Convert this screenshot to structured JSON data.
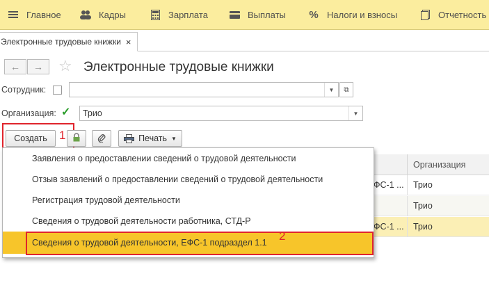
{
  "top_nav": [
    {
      "label": "Главное",
      "icon": "menu-icon"
    },
    {
      "label": "Кадры",
      "icon": "people-icon"
    },
    {
      "label": "Зарплата",
      "icon": "calculator-icon"
    },
    {
      "label": "Выплаты",
      "icon": "wallet-icon"
    },
    {
      "label": "Налоги и взносы",
      "icon": "percent-icon"
    },
    {
      "label": "Отчетность",
      "icon": "document-icon"
    }
  ],
  "tab": {
    "label": "Электронные трудовые книжки",
    "close": "×"
  },
  "page": {
    "title": "Электронные трудовые книжки"
  },
  "filters": {
    "employee_label": "Сотрудник:",
    "employee_value": "",
    "org_label": "Организация:",
    "org_value": "Трио",
    "org_checked": true
  },
  "toolbar": {
    "create_label": "Создать",
    "print_label": "Печать"
  },
  "annotations": {
    "marker1": "1",
    "marker2": "2",
    "color": "#e0242c"
  },
  "menu": {
    "items": [
      "Заявления о предоставлении сведений о трудовой деятельности",
      "Отзыв заявлений о предоставлении сведений о трудовой деятельности",
      "Регистрация трудовой деятельности",
      "Сведения о трудовой деятельности работника, СТД-Р",
      "Сведения о трудовой деятельности, ЕФС-1 подраздел 1.1"
    ],
    "active_index": 4,
    "active_color": "#f7c52a"
  },
  "table": {
    "header": "Организация",
    "rows": [
      {
        "doc": "ФС-1 ...",
        "org": "Трио"
      },
      {
        "doc": "",
        "org": "Трио"
      },
      {
        "doc": "ФС-1 ...",
        "org": "Трио",
        "selected": true
      }
    ]
  }
}
